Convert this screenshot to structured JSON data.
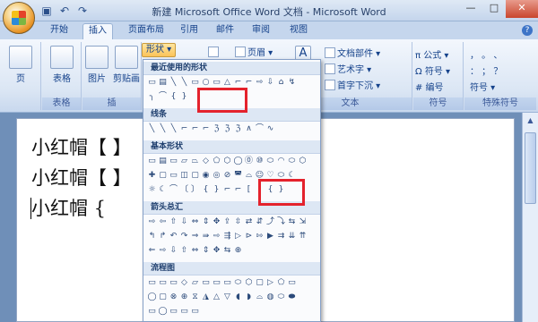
{
  "window": {
    "title": "新建 Microsoft Office Word 文档 - Microsoft Word",
    "controls": [
      "—",
      "□",
      "✕"
    ]
  },
  "quick_access": [
    "save-icon",
    "undo-icon",
    "redo-icon"
  ],
  "tabs": [
    "开始",
    "插入",
    "页面布局",
    "引用",
    "邮件",
    "审阅",
    "视图"
  ],
  "active_tab": "插入",
  "ribbon": {
    "pages_group": {
      "button": "页"
    },
    "tables_group": {
      "button": "表格",
      "label": "表格"
    },
    "illustrations_group": {
      "picture": "图片",
      "clipart": "剪贴画",
      "label": "插",
      "shapes_button": "形状 ▾"
    },
    "header_footer": {
      "header": "页眉 ▾"
    },
    "text_group": {
      "textbox_char": "A",
      "doc_parts": "文档部件 ▾",
      "wordart": "艺术字 ▾",
      "dropcap": "首字下沉 ▾",
      "label": "文本"
    },
    "symbols_group": {
      "formula": "π 公式 ▾",
      "symbol": "Ω 符号 ▾",
      "number": "# 编号",
      "label": "符号"
    },
    "special_group": {
      "row1": "，  。  、",
      "row2": "：  ；  ？",
      "symbol": "符号 ▾",
      "label": "特殊符号"
    }
  },
  "document": {
    "lines": [
      "小红帽【  】",
      "小红帽【  】",
      "小红帽 {"
    ]
  },
  "shapes_menu": {
    "sections": [
      "最近使用的形状",
      "线条",
      "基本形状",
      "箭头总汇",
      "流程图"
    ],
    "recent": [
      "▭",
      "▤",
      "╲",
      "╲",
      "▭",
      "○",
      "▭",
      "△",
      "⌐",
      "⌐",
      "⇨",
      "⇩",
      "⌂",
      "↯",
      "╮",
      "⌒",
      "{",
      "}"
    ],
    "lines": [
      "╲",
      "╲",
      "╲",
      "⌐",
      "⌐",
      "⌐",
      "ℨ",
      "ℨ",
      "ℨ",
      "∧",
      "⌒",
      "∿"
    ],
    "basic1": [
      "▭",
      "▤",
      "▭",
      "▱",
      "⏢",
      "◇",
      "⬠",
      "⬡",
      "◯",
      "⓪",
      "⑩",
      "⬭",
      "◠",
      "⬭",
      "⬡"
    ],
    "basic2": [
      "✚",
      "▢",
      "▭",
      "◫",
      "▢",
      "◉",
      "◎",
      "⊘",
      "◚",
      "⌓",
      "☺",
      "♡",
      "⬭",
      "☾"
    ],
    "basic3": [
      "☼",
      "☾",
      "⌒",
      "〔",
      "〕",
      "{",
      "}",
      "⌐",
      "⌐",
      "[",
      "]",
      "{",
      "}"
    ],
    "arrows1": [
      "⇨",
      "⇦",
      "⇧",
      "⇩",
      "⇔",
      "⇕",
      "✥",
      "⇪",
      "⇳",
      "⇄",
      "⇵",
      "⤴",
      "⤵",
      "⇆",
      "⇲"
    ],
    "arrows2": [
      "↰",
      "↱",
      "↶",
      "↷",
      "⇒",
      "⇛",
      "⇨",
      "⇶",
      "▷",
      "⊳",
      "⇰",
      "▶",
      "⇉",
      "⇊",
      "⇈"
    ],
    "arrows3": [
      "⇐",
      "⇨",
      "⇩",
      "⇧",
      "⇔",
      "⇕",
      "✥",
      "⇆",
      "⊕"
    ],
    "flow1": [
      "▭",
      "▭",
      "▭",
      "◇",
      "▱",
      "▭",
      "▭",
      "▭",
      "⬭",
      "⬡",
      "▢",
      "▷",
      "⬠",
      "▭"
    ],
    "flow2": [
      "◯",
      "▢",
      "⊗",
      "⊕",
      "⧖",
      "◮",
      "△",
      "▽",
      "◖",
      "◗",
      "⌓",
      "◍",
      "⬭",
      "⬬"
    ],
    "flow3": [
      "▭",
      "◯",
      "▭",
      "▭",
      "▭"
    ]
  }
}
